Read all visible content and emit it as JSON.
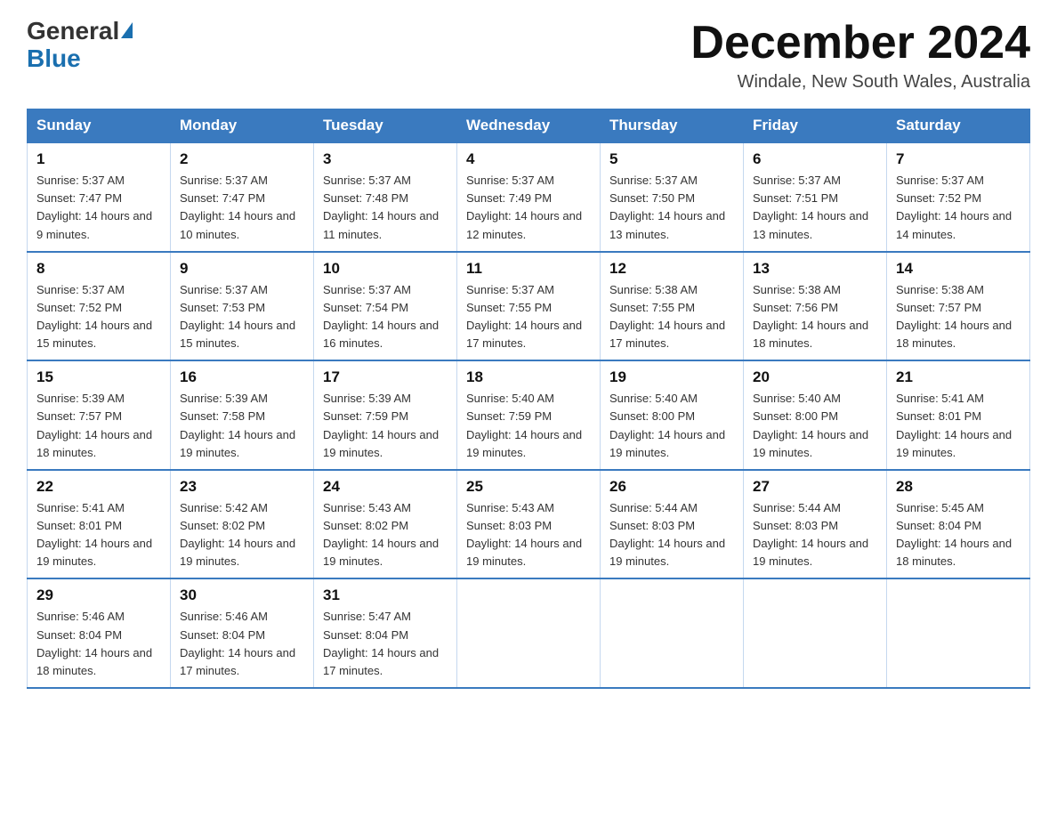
{
  "logo": {
    "general": "General",
    "blue": "Blue",
    "triangle": "▶"
  },
  "header": {
    "month_year": "December 2024",
    "location": "Windale, New South Wales, Australia"
  },
  "weekdays": [
    "Sunday",
    "Monday",
    "Tuesday",
    "Wednesday",
    "Thursday",
    "Friday",
    "Saturday"
  ],
  "weeks": [
    [
      {
        "day": "1",
        "sunrise": "Sunrise: 5:37 AM",
        "sunset": "Sunset: 7:47 PM",
        "daylight": "Daylight: 14 hours and 9 minutes."
      },
      {
        "day": "2",
        "sunrise": "Sunrise: 5:37 AM",
        "sunset": "Sunset: 7:47 PM",
        "daylight": "Daylight: 14 hours and 10 minutes."
      },
      {
        "day": "3",
        "sunrise": "Sunrise: 5:37 AM",
        "sunset": "Sunset: 7:48 PM",
        "daylight": "Daylight: 14 hours and 11 minutes."
      },
      {
        "day": "4",
        "sunrise": "Sunrise: 5:37 AM",
        "sunset": "Sunset: 7:49 PM",
        "daylight": "Daylight: 14 hours and 12 minutes."
      },
      {
        "day": "5",
        "sunrise": "Sunrise: 5:37 AM",
        "sunset": "Sunset: 7:50 PM",
        "daylight": "Daylight: 14 hours and 13 minutes."
      },
      {
        "day": "6",
        "sunrise": "Sunrise: 5:37 AM",
        "sunset": "Sunset: 7:51 PM",
        "daylight": "Daylight: 14 hours and 13 minutes."
      },
      {
        "day": "7",
        "sunrise": "Sunrise: 5:37 AM",
        "sunset": "Sunset: 7:52 PM",
        "daylight": "Daylight: 14 hours and 14 minutes."
      }
    ],
    [
      {
        "day": "8",
        "sunrise": "Sunrise: 5:37 AM",
        "sunset": "Sunset: 7:52 PM",
        "daylight": "Daylight: 14 hours and 15 minutes."
      },
      {
        "day": "9",
        "sunrise": "Sunrise: 5:37 AM",
        "sunset": "Sunset: 7:53 PM",
        "daylight": "Daylight: 14 hours and 15 minutes."
      },
      {
        "day": "10",
        "sunrise": "Sunrise: 5:37 AM",
        "sunset": "Sunset: 7:54 PM",
        "daylight": "Daylight: 14 hours and 16 minutes."
      },
      {
        "day": "11",
        "sunrise": "Sunrise: 5:37 AM",
        "sunset": "Sunset: 7:55 PM",
        "daylight": "Daylight: 14 hours and 17 minutes."
      },
      {
        "day": "12",
        "sunrise": "Sunrise: 5:38 AM",
        "sunset": "Sunset: 7:55 PM",
        "daylight": "Daylight: 14 hours and 17 minutes."
      },
      {
        "day": "13",
        "sunrise": "Sunrise: 5:38 AM",
        "sunset": "Sunset: 7:56 PM",
        "daylight": "Daylight: 14 hours and 18 minutes."
      },
      {
        "day": "14",
        "sunrise": "Sunrise: 5:38 AM",
        "sunset": "Sunset: 7:57 PM",
        "daylight": "Daylight: 14 hours and 18 minutes."
      }
    ],
    [
      {
        "day": "15",
        "sunrise": "Sunrise: 5:39 AM",
        "sunset": "Sunset: 7:57 PM",
        "daylight": "Daylight: 14 hours and 18 minutes."
      },
      {
        "day": "16",
        "sunrise": "Sunrise: 5:39 AM",
        "sunset": "Sunset: 7:58 PM",
        "daylight": "Daylight: 14 hours and 19 minutes."
      },
      {
        "day": "17",
        "sunrise": "Sunrise: 5:39 AM",
        "sunset": "Sunset: 7:59 PM",
        "daylight": "Daylight: 14 hours and 19 minutes."
      },
      {
        "day": "18",
        "sunrise": "Sunrise: 5:40 AM",
        "sunset": "Sunset: 7:59 PM",
        "daylight": "Daylight: 14 hours and 19 minutes."
      },
      {
        "day": "19",
        "sunrise": "Sunrise: 5:40 AM",
        "sunset": "Sunset: 8:00 PM",
        "daylight": "Daylight: 14 hours and 19 minutes."
      },
      {
        "day": "20",
        "sunrise": "Sunrise: 5:40 AM",
        "sunset": "Sunset: 8:00 PM",
        "daylight": "Daylight: 14 hours and 19 minutes."
      },
      {
        "day": "21",
        "sunrise": "Sunrise: 5:41 AM",
        "sunset": "Sunset: 8:01 PM",
        "daylight": "Daylight: 14 hours and 19 minutes."
      }
    ],
    [
      {
        "day": "22",
        "sunrise": "Sunrise: 5:41 AM",
        "sunset": "Sunset: 8:01 PM",
        "daylight": "Daylight: 14 hours and 19 minutes."
      },
      {
        "day": "23",
        "sunrise": "Sunrise: 5:42 AM",
        "sunset": "Sunset: 8:02 PM",
        "daylight": "Daylight: 14 hours and 19 minutes."
      },
      {
        "day": "24",
        "sunrise": "Sunrise: 5:43 AM",
        "sunset": "Sunset: 8:02 PM",
        "daylight": "Daylight: 14 hours and 19 minutes."
      },
      {
        "day": "25",
        "sunrise": "Sunrise: 5:43 AM",
        "sunset": "Sunset: 8:03 PM",
        "daylight": "Daylight: 14 hours and 19 minutes."
      },
      {
        "day": "26",
        "sunrise": "Sunrise: 5:44 AM",
        "sunset": "Sunset: 8:03 PM",
        "daylight": "Daylight: 14 hours and 19 minutes."
      },
      {
        "day": "27",
        "sunrise": "Sunrise: 5:44 AM",
        "sunset": "Sunset: 8:03 PM",
        "daylight": "Daylight: 14 hours and 19 minutes."
      },
      {
        "day": "28",
        "sunrise": "Sunrise: 5:45 AM",
        "sunset": "Sunset: 8:04 PM",
        "daylight": "Daylight: 14 hours and 18 minutes."
      }
    ],
    [
      {
        "day": "29",
        "sunrise": "Sunrise: 5:46 AM",
        "sunset": "Sunset: 8:04 PM",
        "daylight": "Daylight: 14 hours and 18 minutes."
      },
      {
        "day": "30",
        "sunrise": "Sunrise: 5:46 AM",
        "sunset": "Sunset: 8:04 PM",
        "daylight": "Daylight: 14 hours and 17 minutes."
      },
      {
        "day": "31",
        "sunrise": "Sunrise: 5:47 AM",
        "sunset": "Sunset: 8:04 PM",
        "daylight": "Daylight: 14 hours and 17 minutes."
      },
      null,
      null,
      null,
      null
    ]
  ]
}
